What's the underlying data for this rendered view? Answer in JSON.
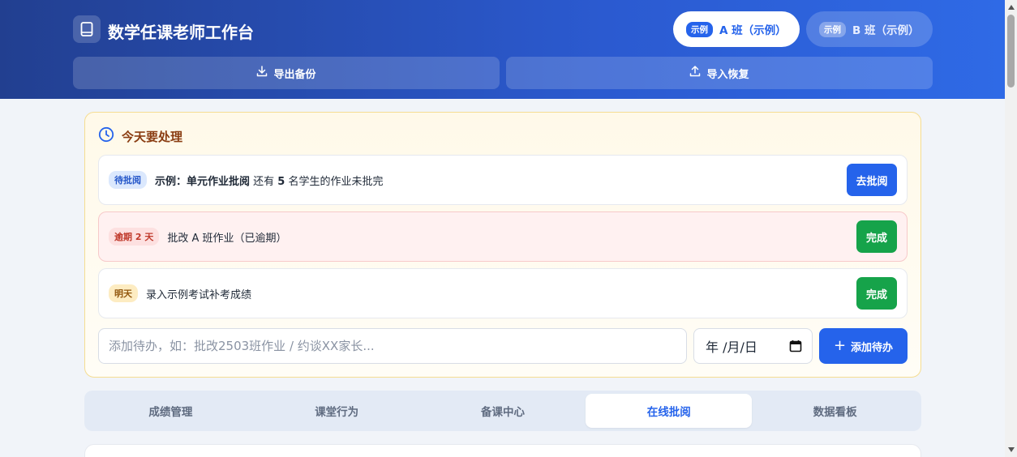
{
  "header": {
    "app_title": "数学任课老师工作台",
    "app_icon": "book-icon",
    "class_tabs": [
      {
        "badge": "示例",
        "label": "A 班（示例）",
        "active": true
      },
      {
        "badge": "示例",
        "label": "B 班（示例）",
        "active": false
      }
    ],
    "export_label": "导出备份",
    "import_label": "导入恢复"
  },
  "today": {
    "title": "今天要处理",
    "items": [
      {
        "tag": "待批阅",
        "text_prefix": "示例：单元作业批阅",
        "text_mid1": " 还有 ",
        "count": "5",
        "text_mid2": " 名学生的作业未批完",
        "button": "去批阅"
      },
      {
        "tag": "逾期 2 天",
        "text": "批改 A 班作业（已逾期）",
        "button": "完成"
      },
      {
        "tag": "明天",
        "text": "录入示例考试补考成绩",
        "button": "完成"
      }
    ],
    "input_placeholder": "添加待办，如：批改2503班作业 / 约谈XX家长...",
    "date_placeholder": "年 /月/日",
    "add_label": "添加待办"
  },
  "tabs": [
    {
      "label": "成绩管理",
      "active": false
    },
    {
      "label": "课堂行为",
      "active": false
    },
    {
      "label": "备课中心",
      "active": false
    },
    {
      "label": "在线批阅",
      "active": true
    },
    {
      "label": "数据看板",
      "active": false
    }
  ],
  "colors": {
    "primary": "#2563eb",
    "success": "#16a34a",
    "header_start": "#223f90",
    "header_end": "#2f6ae6"
  }
}
